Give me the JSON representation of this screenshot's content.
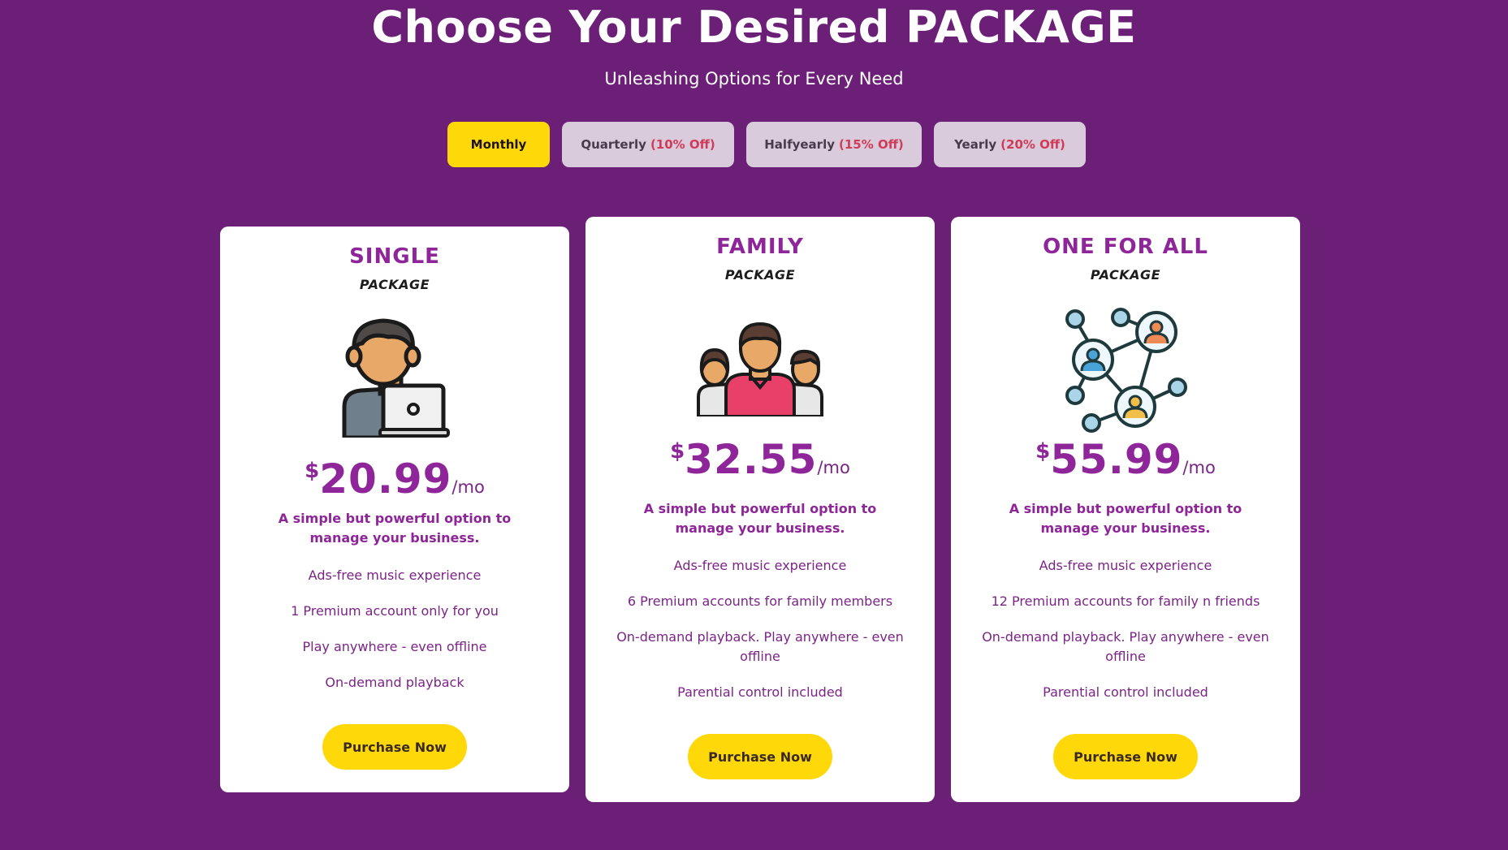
{
  "header": {
    "title": "Choose Your Desired PACKAGE",
    "subtitle": "Unleashing Options for Every Need"
  },
  "billing_tabs": [
    {
      "label": "Monthly",
      "discount": "",
      "active": true
    },
    {
      "label": "Quarterly",
      "discount": "(10% Off)",
      "active": false
    },
    {
      "label": "Halfyearly",
      "discount": "(15% Off)",
      "active": false
    },
    {
      "label": "Yearly",
      "discount": "(20% Off)",
      "active": false
    }
  ],
  "plans": [
    {
      "name": "SINGLE",
      "subtitle": "PACKAGE",
      "icon": "person-laptop-icon",
      "currency": "$",
      "price": "20.99",
      "period": "/mo",
      "description": "A simple but powerful option to manage your business.",
      "features": [
        "Ads-free music experience",
        "1 Premium account only for you",
        "Play anywhere - even offline",
        "On-demand playback"
      ],
      "button": "Purchase Now"
    },
    {
      "name": "FAMILY",
      "subtitle": "PACKAGE",
      "icon": "family-icon",
      "currency": "$",
      "price": "32.55",
      "period": "/mo",
      "description": "A simple but powerful option to manage your business.",
      "features": [
        "Ads-free music experience",
        "6 Premium accounts for family members",
        "On-demand playback. Play anywhere - even offline",
        "Parential control included"
      ],
      "button": "Purchase Now"
    },
    {
      "name": "ONE FOR ALL",
      "subtitle": "PACKAGE",
      "icon": "network-users-icon",
      "currency": "$",
      "price": "55.99",
      "period": "/mo",
      "description": "A simple but powerful option to manage your business.",
      "features": [
        "Ads-free music experience",
        "12 Premium accounts for family n friends",
        "On-demand playback. Play anywhere - even offline",
        "Parential control included"
      ],
      "button": "Purchase Now"
    }
  ],
  "colors": {
    "background": "#6b1f77",
    "accent": "#ffd809",
    "plan_text": "#8e2599",
    "discount": "#d03b58"
  }
}
